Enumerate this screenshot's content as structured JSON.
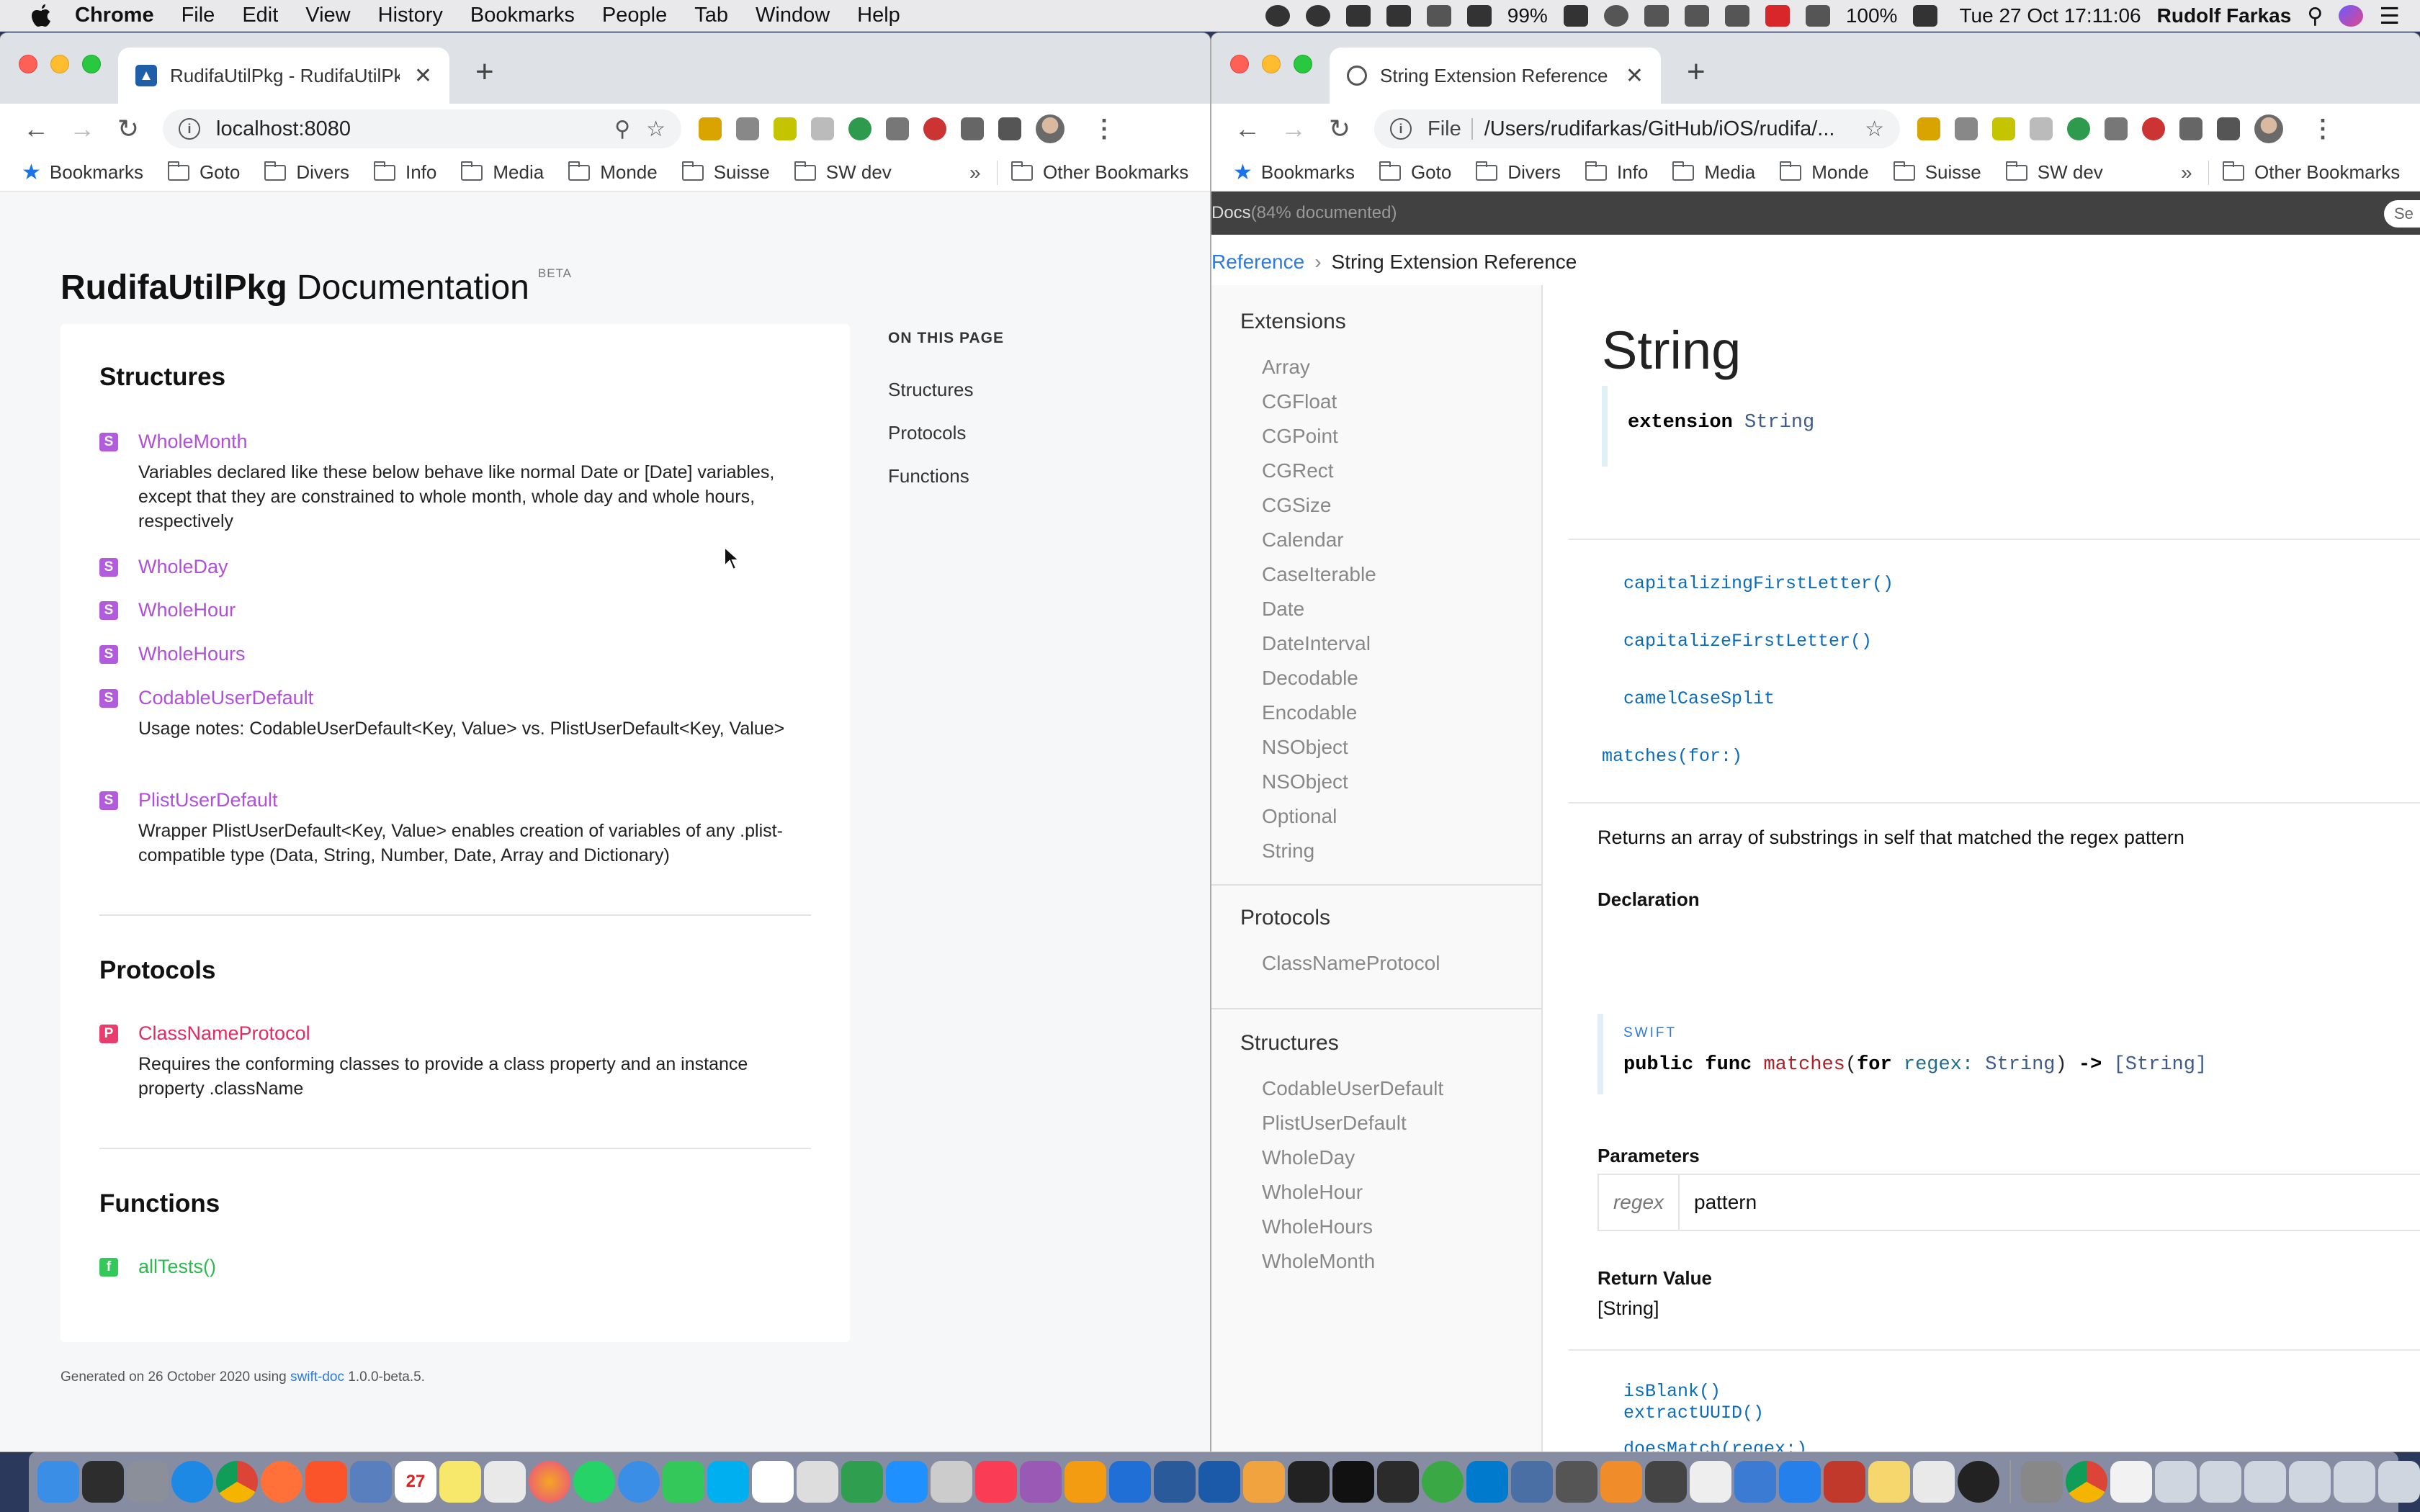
{
  "menubar": {
    "app": "Chrome",
    "items": [
      "File",
      "Edit",
      "View",
      "History",
      "Bookmarks",
      "People",
      "Tab",
      "Window",
      "Help"
    ],
    "battery_small": "99%",
    "volume": "100%",
    "datetime": "Tue 27 Oct  17:11:06",
    "user": "Rudolf Farkas"
  },
  "left_window": {
    "tab_title": "RudifaUtilPkg - RudifaUtilPkg",
    "url": "localhost:8080",
    "bookmarks": [
      "Bookmarks",
      "Goto",
      "Divers",
      "Info",
      "Media",
      "Monde",
      "Suisse",
      "SW dev"
    ],
    "bookmarks_overflow": "»",
    "other_bookmarks": "Other Bookmarks",
    "page": {
      "title_bold": "RudifaUtilPkg",
      "title_rest": " Documentation",
      "beta": "BETA",
      "structures_heading": "Structures",
      "structures": [
        {
          "badge": "S",
          "name": "WholeMonth",
          "desc": "Variables declared like these below behave like normal Date or [Date] variables, except that they are constrained to whole month, whole day and whole hours, respectively"
        },
        {
          "badge": "S",
          "name": "WholeDay",
          "desc": ""
        },
        {
          "badge": "S",
          "name": "WholeHour",
          "desc": ""
        },
        {
          "badge": "S",
          "name": "WholeHours",
          "desc": ""
        },
        {
          "badge": "S",
          "name": "CodableUserDefault",
          "desc": "Usage notes: CodableUserDefault<Key, Value> vs. PlistUserDefault<Key, Value>"
        },
        {
          "badge": "S",
          "name": "PlistUserDefault",
          "desc": "Wrapper PlistUserDefault<Key, Value> enables creation of variables of any .plist-compatible type (Data, String, Number, Date, Array and Dictionary)"
        }
      ],
      "protocols_heading": "Protocols",
      "protocols": [
        {
          "badge": "P",
          "name": "ClassNameProtocol",
          "desc": "Requires the conforming classes to provide a class property and an instance property .className"
        }
      ],
      "functions_heading": "Functions",
      "functions": [
        {
          "badge": "f",
          "name": "allTests()"
        }
      ],
      "on_this_page": "ON THIS PAGE",
      "on_this_page_links": [
        "Structures",
        "Protocols",
        "Functions"
      ],
      "footer_pre": "Generated on 26 October 2020 using ",
      "footer_link": "swift-doc",
      "footer_post": " 1.0.0-beta.5."
    }
  },
  "right_window": {
    "tab_title": "String Extension Reference",
    "url_prefix": "File",
    "url": "/Users/rudifarkas/GitHub/iOS/rudifa/...",
    "bookmarks": [
      "Bookmarks",
      "Goto",
      "Divers",
      "Info",
      "Media",
      "Monde",
      "Suisse",
      "SW dev"
    ],
    "bookmarks_overflow": "»",
    "other_bookmarks": "Other Bookmarks",
    "page": {
      "header_docs": "Docs",
      "header_documented": " (84% documented)",
      "search_placeholder": "Se",
      "crumb_link": "Reference",
      "crumb_current": "String Extension Reference",
      "nav": {
        "extensions_heading": "Extensions",
        "extensions": [
          "Array",
          "CGFloat",
          "CGPoint",
          "CGRect",
          "CGSize",
          "Calendar",
          "CaseIterable",
          "Date",
          "DateInterval",
          "Decodable",
          "Encodable",
          "NSObject",
          "NSObject",
          "Optional",
          "String"
        ],
        "protocols_heading": "Protocols",
        "protocols": [
          "ClassNameProtocol"
        ],
        "structures_heading": "Structures",
        "structures": [
          "CodableUserDefault",
          "PlistUserDefault",
          "WholeDay",
          "WholeHour",
          "WholeHours",
          "WholeMonth"
        ]
      },
      "title": "String",
      "declaration_kw": "extension",
      "declaration_type": "String",
      "tasks_top": [
        "capitalizingFirstLetter()",
        "capitalizeFirstLetter()",
        "camelCaseSplit"
      ],
      "task_open": "matches(for:)",
      "abstract": "Returns an array of substrings in self that matched the regex pattern",
      "declaration_heading": "Declaration",
      "swift_label": "SWIFT",
      "sig": {
        "kw1": "public func",
        "fn": "matches",
        "p1": "(",
        "kw2": "for",
        "arg": "regex",
        "colon": ":",
        "ty1": "String",
        "close": ")",
        "arrow": "->",
        "ret": "[String]"
      },
      "parameters_heading": "Parameters",
      "param_name": "regex",
      "param_desc": "pattern",
      "return_heading": "Return Value",
      "return_value": "[String]",
      "tasks_bottom": [
        "isBlank()",
        "doesMatch(regex:)",
        "extractUUID()"
      ]
    }
  },
  "dock": {
    "calendar_day": "27"
  }
}
